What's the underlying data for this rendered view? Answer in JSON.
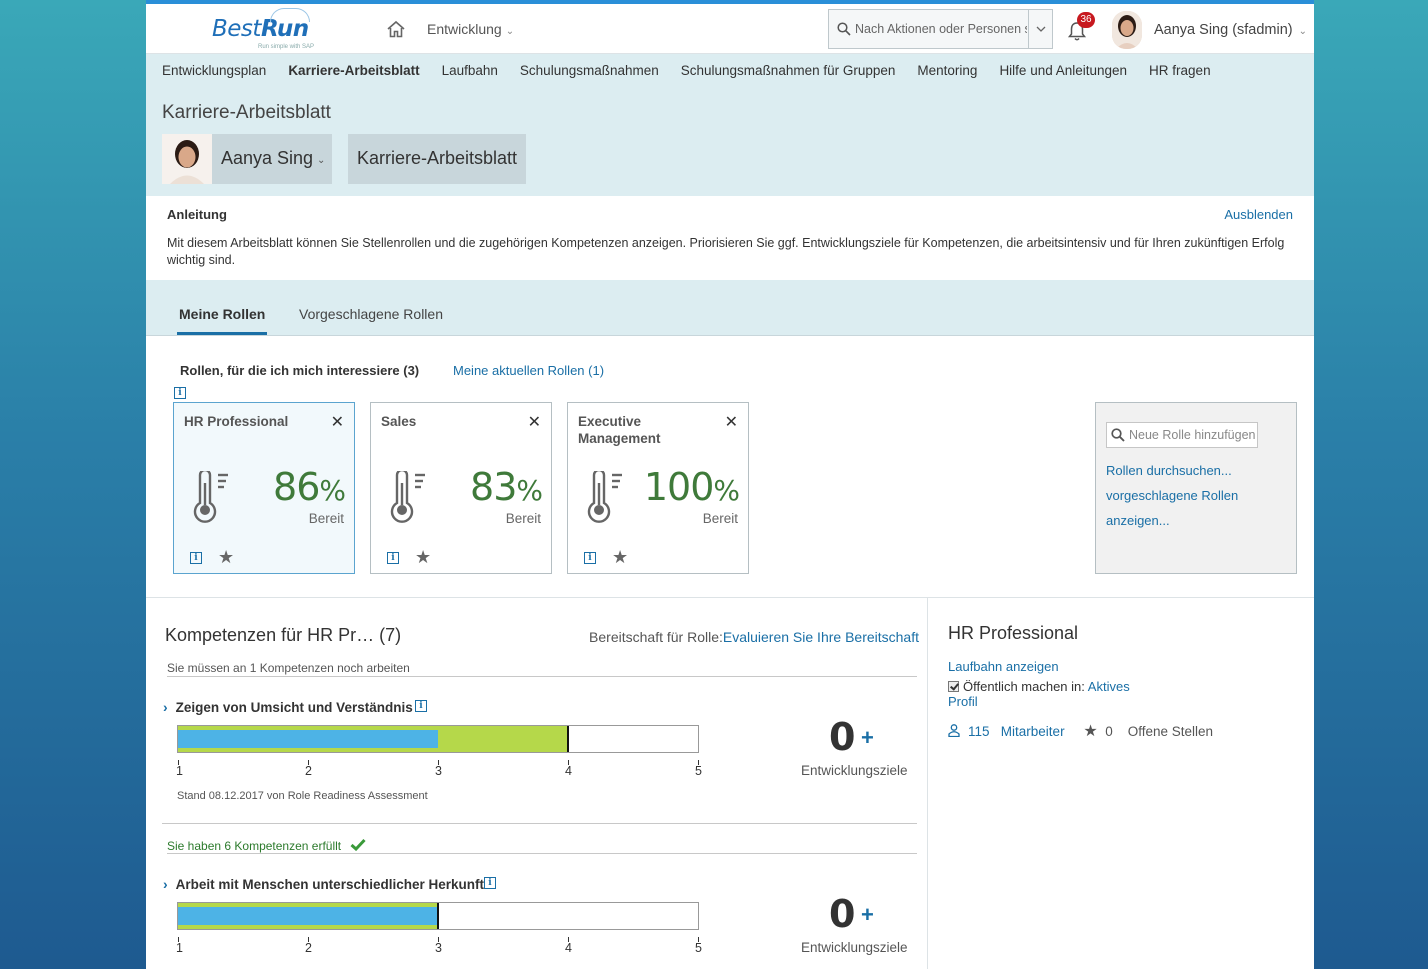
{
  "header": {
    "logo_main": "Best",
    "logo_accent": "Run",
    "logo_tagline": "Run simple with SAP",
    "module": "Entwicklung",
    "search_placeholder": "Nach Aktionen oder Personen suchen",
    "notifications": "36",
    "user": "Aanya Sing (sfadmin)"
  },
  "nav": {
    "items": [
      "Entwicklungsplan",
      "Karriere-Arbeitsblatt",
      "Laufbahn",
      "Schulungsmaßnahmen",
      "Schulungsmaßnahmen für Gruppen",
      "Mentoring",
      "Hilfe und Anleitungen",
      "HR fragen"
    ],
    "active": "Karriere-Arbeitsblatt"
  },
  "page": {
    "title": "Karriere-Arbeitsblatt",
    "person": "Aanya Sing",
    "sheet": "Karriere-Arbeitsblatt"
  },
  "instructions": {
    "heading": "Anleitung",
    "hide": "Ausblenden",
    "text": "Mit diesem Arbeitsblatt können Sie Stellenrollen und die zugehörigen Kompetenzen anzeigen. Priorisieren Sie ggf. Entwicklungsziele für Kompetenzen, die arbeitsintensiv und für Ihren zukünftigen Erfolg wichtig sind."
  },
  "tabs": {
    "my_roles": "Meine Rollen",
    "suggested": "Vorgeschlagene Rollen"
  },
  "roles": {
    "heading": "Rollen, für die ich mich interessiere (3)",
    "current_link": "Meine aktuellen Rollen (1)",
    "cards": [
      {
        "title": "HR Professional",
        "value": "86",
        "unit": "%",
        "label": "Bereit"
      },
      {
        "title": "Sales",
        "value": "83",
        "unit": "%",
        "label": "Bereit"
      },
      {
        "title": "Executive Management",
        "value": "100",
        "unit": "%",
        "label": "Bereit"
      }
    ],
    "add_placeholder": "Neue Rolle hinzufügen",
    "browse": "Rollen durchsuchen...",
    "suggested_line1": "vorgeschlagene Rollen",
    "suggested_line2": "anzeigen..."
  },
  "competencies": {
    "title": "Kompetenzen für HR Pr…",
    "count": "(7)",
    "ready_label": "Bereitschaft für Rolle:",
    "ready_link": "Evaluieren Sie Ihre Bereitschaft",
    "pending_hint": "Sie müssen an 1 Kompetenzen noch arbeiten",
    "met_hint": "Sie haben 6 Kompetenzen erfüllt",
    "scale": [
      "1",
      "2",
      "3",
      "4",
      "5"
    ],
    "items": [
      {
        "name": "Zeigen von Umsicht und Verständnis",
        "current": 3,
        "required": 4,
        "goals": "0",
        "goals_label": "Entwicklungsziele",
        "stand": "Stand 08.12.2017 von Role Readiness Assessment"
      },
      {
        "name": "Arbeit mit Menschen unterschiedlicher Herkunft",
        "current": 3,
        "required": 3,
        "goals": "0",
        "goals_label": "Entwicklungsziele"
      }
    ]
  },
  "side": {
    "title": "HR Professional",
    "career_link": "Laufbahn anzeigen",
    "public_label": "Öffentlich machen in:",
    "public_link_1": "Aktives",
    "public_link_2": "Profil",
    "employees_count": "115",
    "employees_label": "Mitarbeiter",
    "open_count": "0",
    "open_label": "Offene Stellen"
  },
  "colors": {
    "accent": "#1a6fa6",
    "readiness_green": "#3f7a3a",
    "bar_blue": "#4db3e6",
    "bar_green": "#b5d84a"
  }
}
